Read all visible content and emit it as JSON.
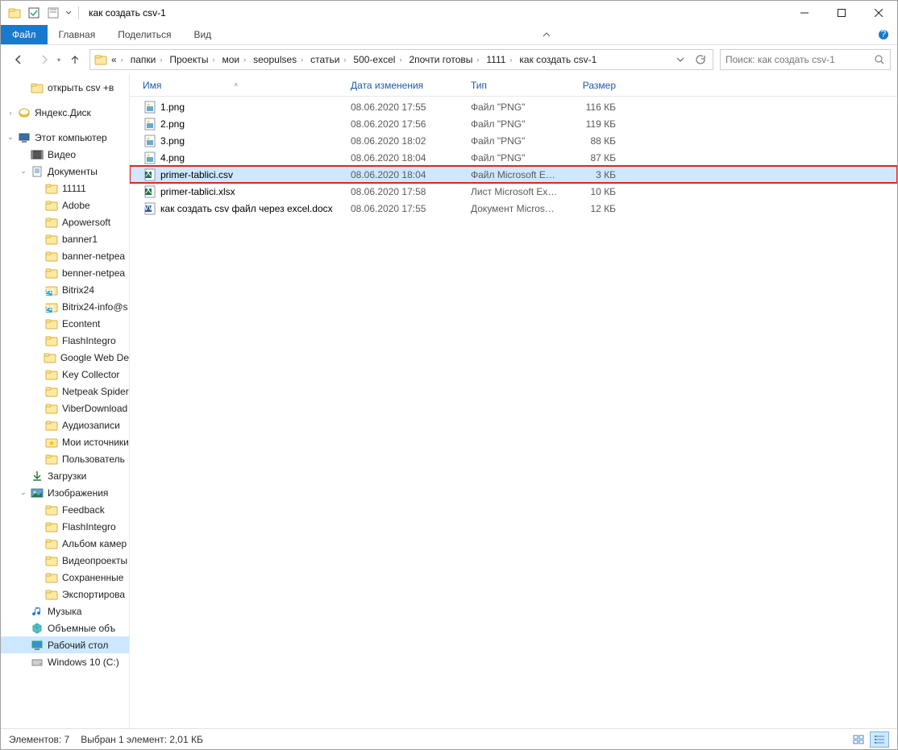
{
  "window_title": "как создать csv-1",
  "ribbon": {
    "file": "Файл",
    "home": "Главная",
    "share": "Поделиться",
    "view": "Вид"
  },
  "breadcrumbs": [
    "папки",
    "Проекты",
    "мои",
    "seopulses",
    "статьи",
    "500-excel",
    "2почти готовы",
    "1111",
    "как создать csv-1"
  ],
  "search_placeholder": "Поиск: как создать csv-1",
  "columns": {
    "name": "Имя",
    "date": "Дата изменения",
    "type": "Тип",
    "size": "Размер"
  },
  "files": [
    {
      "icon": "png",
      "name": "1.png",
      "date": "08.06.2020 17:55",
      "type": "Файл \"PNG\"",
      "size": "116 КБ"
    },
    {
      "icon": "png",
      "name": "2.png",
      "date": "08.06.2020 17:56",
      "type": "Файл \"PNG\"",
      "size": "119 КБ"
    },
    {
      "icon": "png",
      "name": "3.png",
      "date": "08.06.2020 18:02",
      "type": "Файл \"PNG\"",
      "size": "88 КБ"
    },
    {
      "icon": "png",
      "name": "4.png",
      "date": "08.06.2020 18:04",
      "type": "Файл \"PNG\"",
      "size": "87 КБ"
    },
    {
      "icon": "xls",
      "name": "primer-tablici.csv",
      "date": "08.06.2020 18:04",
      "type": "Файл Microsoft E…",
      "size": "3 КБ",
      "selected": true
    },
    {
      "icon": "xls",
      "name": "primer-tablici.xlsx",
      "date": "08.06.2020 17:58",
      "type": "Лист Microsoft Ex…",
      "size": "10 КБ"
    },
    {
      "icon": "doc",
      "name": "как создать csv файл через excel.docx",
      "date": "08.06.2020 17:55",
      "type": "Документ Micros…",
      "size": "12 КБ"
    }
  ],
  "tree": [
    {
      "lvl": 1,
      "ic": "folder",
      "label": "открыть csv +в",
      "pad": true
    },
    {
      "lvl": 0,
      "ic": "yadisk",
      "label": "Яндекс.Диск",
      "exp": ">",
      "pad": true
    },
    {
      "lvl": 0,
      "ic": "pc",
      "label": "Этот компьютер",
      "exp": "v"
    },
    {
      "lvl": 1,
      "ic": "video",
      "label": "Видео"
    },
    {
      "lvl": 1,
      "ic": "docs",
      "label": "Документы",
      "exp": "v"
    },
    {
      "lvl": 2,
      "ic": "folder",
      "label": "11111"
    },
    {
      "lvl": 2,
      "ic": "folder",
      "label": "Adobe"
    },
    {
      "lvl": 2,
      "ic": "folder",
      "label": "Apowersoft"
    },
    {
      "lvl": 2,
      "ic": "folder",
      "label": "banner1"
    },
    {
      "lvl": 2,
      "ic": "folder",
      "label": "banner-netpea"
    },
    {
      "lvl": 2,
      "ic": "folder",
      "label": "benner-netpea"
    },
    {
      "lvl": 2,
      "ic": "b24",
      "label": "Bitrix24"
    },
    {
      "lvl": 2,
      "ic": "b24",
      "label": "Bitrix24-info@s"
    },
    {
      "lvl": 2,
      "ic": "folder",
      "label": "Econtent"
    },
    {
      "lvl": 2,
      "ic": "folder",
      "label": "FlashIntegro"
    },
    {
      "lvl": 2,
      "ic": "folder",
      "label": "Google Web De"
    },
    {
      "lvl": 2,
      "ic": "folder",
      "label": "Key Collector"
    },
    {
      "lvl": 2,
      "ic": "folder",
      "label": "Netpeak Spider"
    },
    {
      "lvl": 2,
      "ic": "folder",
      "label": "ViberDownload"
    },
    {
      "lvl": 2,
      "ic": "folder",
      "label": "Аудиозаписи"
    },
    {
      "lvl": 2,
      "ic": "fav",
      "label": "Мои источники"
    },
    {
      "lvl": 2,
      "ic": "folder",
      "label": "Пользователь"
    },
    {
      "lvl": 1,
      "ic": "download",
      "label": "Загрузки"
    },
    {
      "lvl": 1,
      "ic": "pictures",
      "label": "Изображения",
      "exp": "v"
    },
    {
      "lvl": 2,
      "ic": "folder",
      "label": "Feedback"
    },
    {
      "lvl": 2,
      "ic": "folder",
      "label": "FlashIntegro"
    },
    {
      "lvl": 2,
      "ic": "folder",
      "label": "Альбом камер"
    },
    {
      "lvl": 2,
      "ic": "folder",
      "label": "Видеопроекты"
    },
    {
      "lvl": 2,
      "ic": "folder",
      "label": "Сохраненные"
    },
    {
      "lvl": 2,
      "ic": "folder",
      "label": "Экспортирова"
    },
    {
      "lvl": 1,
      "ic": "music",
      "label": "Музыка"
    },
    {
      "lvl": 1,
      "ic": "3d",
      "label": "Объемные объ"
    },
    {
      "lvl": 1,
      "ic": "desktop",
      "label": "Рабочий стол",
      "sel": true
    },
    {
      "lvl": 1,
      "ic": "disk",
      "label": "Windows 10 (C:)"
    }
  ],
  "status": {
    "items": "Элементов: 7",
    "selected": "Выбран 1 элемент: 2,01 КБ"
  }
}
